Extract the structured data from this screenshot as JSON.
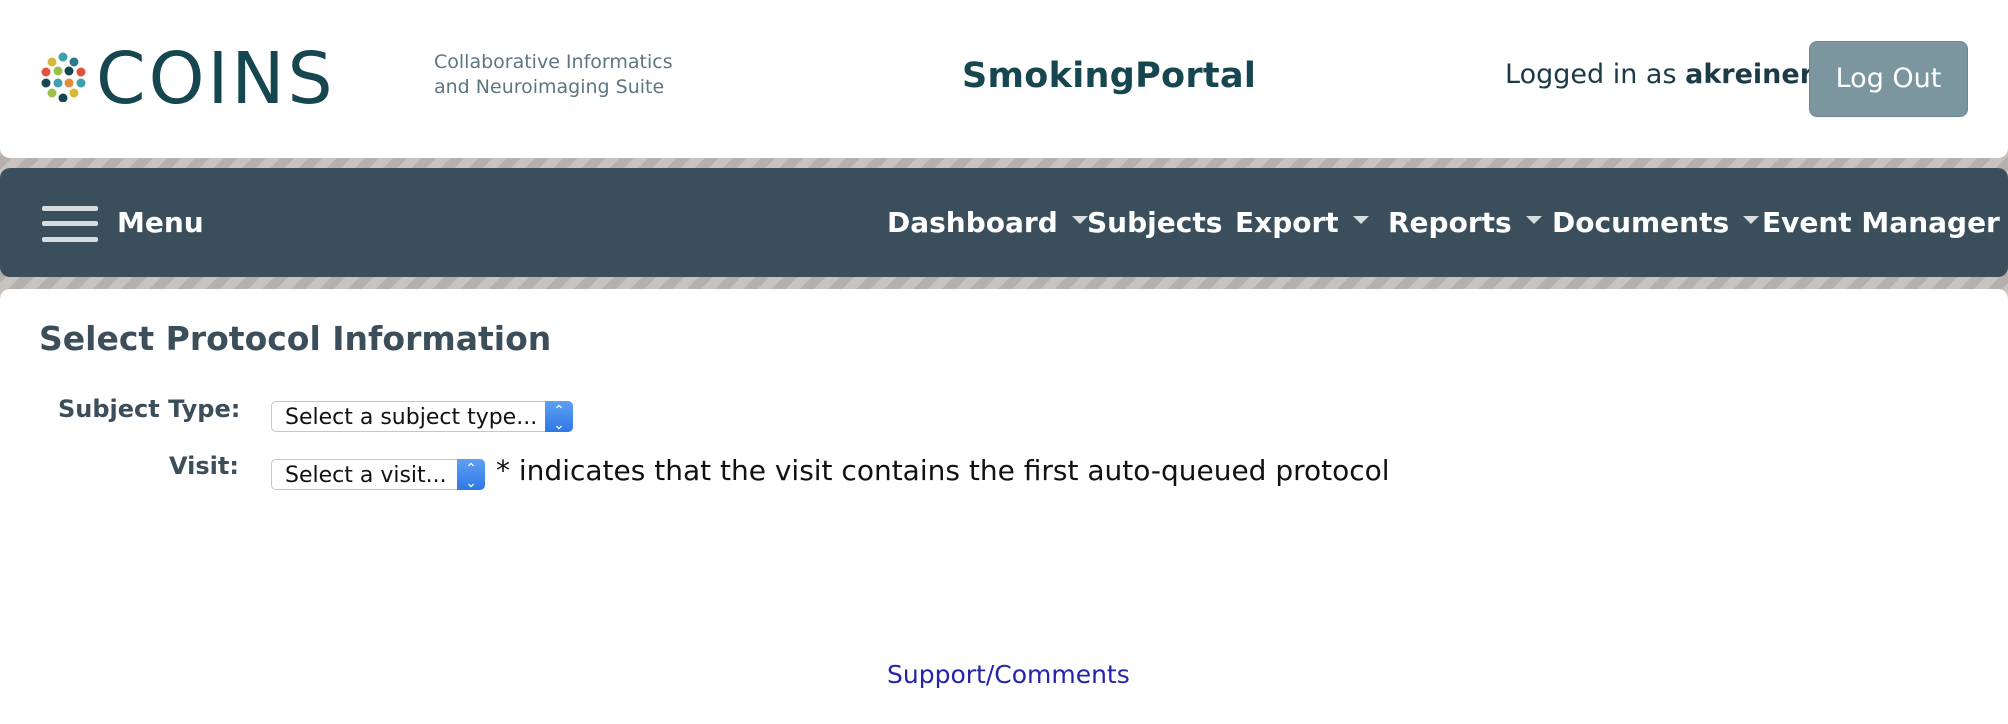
{
  "header": {
    "logo_text": "COINS",
    "tagline_line1": "Collaborative Informatics",
    "tagline_line2": "and Neuroimaging Suite",
    "portal_name": "SmokingPortal",
    "logged_in_prefix": "Logged in as",
    "username": "akreiner",
    "logout_label": "Log Out"
  },
  "navbar": {
    "menu_label": "Menu",
    "items": [
      {
        "label": "Dashboard",
        "has_dropdown": true
      },
      {
        "label": "Subjects",
        "has_dropdown": false
      },
      {
        "label": "Export",
        "has_dropdown": true
      },
      {
        "label": "Reports",
        "has_dropdown": true
      },
      {
        "label": "Documents",
        "has_dropdown": true
      },
      {
        "label": "Event Manager",
        "has_dropdown": true
      }
    ]
  },
  "main": {
    "title": "Select Protocol Information",
    "subject_type_label": "Subject Type:",
    "subject_type_value": "Select a subject type...",
    "visit_label": "Visit:",
    "visit_value": "Select a visit...",
    "visit_hint": "* indicates that the visit contains the first auto-queued protocol",
    "support_link": "Support/Comments"
  },
  "colors": {
    "brand_dark": "#16464f",
    "navbar_bg": "#3a4e5b",
    "logout_bg": "#7c96a0",
    "link": "#2424a8"
  }
}
